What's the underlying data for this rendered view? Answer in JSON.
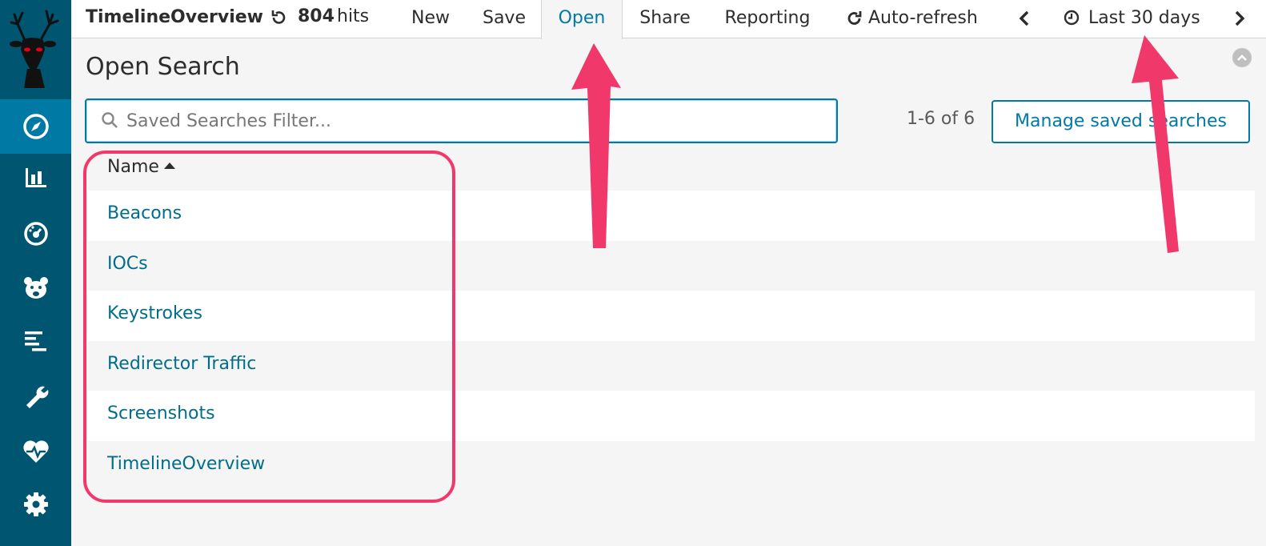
{
  "sidebar": {
    "items": [
      {
        "icon": "compass-icon",
        "active": true
      },
      {
        "icon": "bar-chart-icon",
        "active": false
      },
      {
        "icon": "dashboard-gauge-icon",
        "active": false
      },
      {
        "icon": "bear-face-icon",
        "active": false
      },
      {
        "icon": "timeline-lines-icon",
        "active": false
      },
      {
        "icon": "wrench-icon",
        "active": false
      },
      {
        "icon": "heartbeat-icon",
        "active": false
      },
      {
        "icon": "gear-icon",
        "active": false
      }
    ]
  },
  "topbar": {
    "title": "TimelineOverview",
    "hits_count": "804",
    "hits_label": "hits",
    "menu": {
      "new": "New",
      "save": "Save",
      "open": "Open",
      "share": "Share",
      "reporting": "Reporting",
      "auto_refresh": "Auto-refresh"
    },
    "time_range": "Last 30 days"
  },
  "open_search": {
    "title": "Open Search",
    "filter_placeholder": "Saved Searches Filter...",
    "filter_value": "",
    "pager": "1-6 of 6",
    "manage_button": "Manage saved searches",
    "column_header": "Name",
    "rows": [
      "Beacons",
      "IOCs",
      "Keystrokes",
      "Redirector Traffic",
      "Screenshots",
      "TimelineOverview"
    ]
  },
  "colors": {
    "sidebar": "#005571",
    "sidebar_active": "#0079a5",
    "accent": "#0079a5",
    "link": "#006e8a",
    "annotation": "#f0386b"
  }
}
